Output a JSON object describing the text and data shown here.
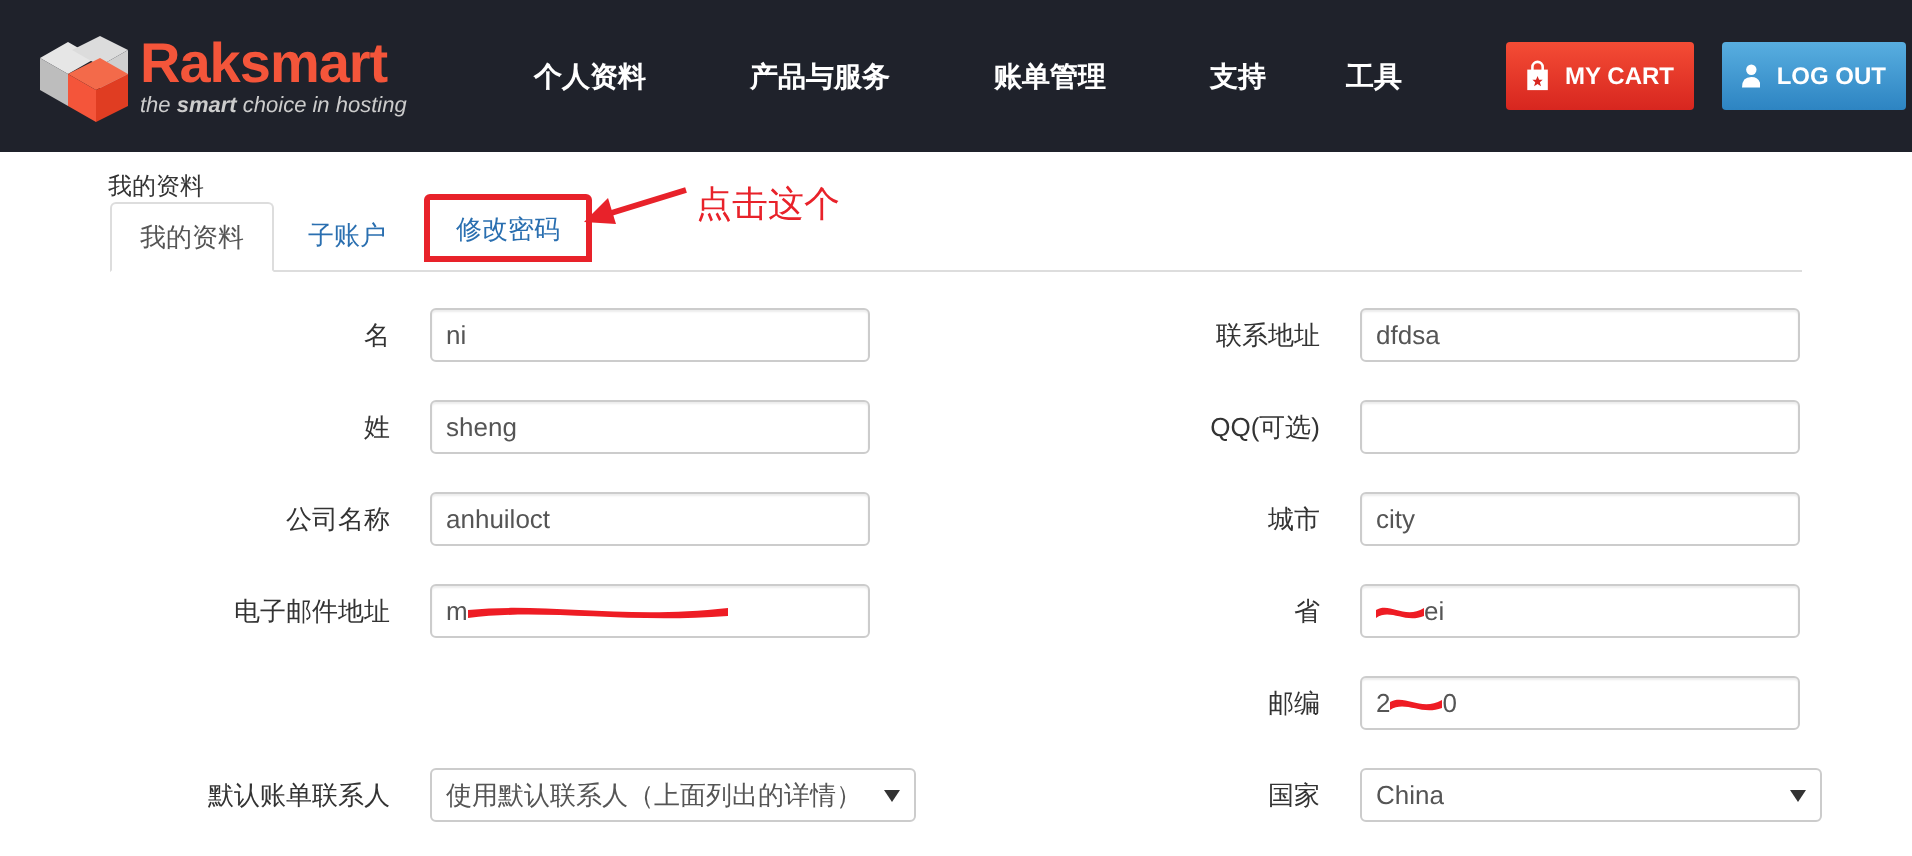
{
  "header": {
    "logo": {
      "name": "Raksmart",
      "tagline_before": "the ",
      "tagline_bold": "smart",
      "tagline_after": " choice in hosting"
    },
    "nav": [
      "个人资料",
      "产品与服务",
      "账单管理",
      "支持",
      "工具"
    ],
    "buttons": [
      {
        "label": "MY CART",
        "kind": "cart"
      },
      {
        "label": "LOG OUT",
        "kind": "logout"
      }
    ]
  },
  "breadcrumb": "我的资料",
  "tabs": [
    {
      "label": "我的资料",
      "selected": true,
      "highlighted": false
    },
    {
      "label": "子账户",
      "selected": false,
      "highlighted": false
    },
    {
      "label": "修改密码",
      "selected": false,
      "highlighted": true
    }
  ],
  "annotation": "点击这个",
  "rows": [
    {
      "left": {
        "label": "名",
        "kind": "text",
        "value": "ni"
      },
      "right": {
        "label": "联系地址",
        "kind": "text",
        "value": "dfdsa"
      }
    },
    {
      "left": {
        "label": "姓",
        "kind": "text",
        "value": "sheng"
      },
      "right": {
        "label": "QQ(可选)",
        "kind": "text"
      }
    },
    {
      "left": {
        "label": "公司名称",
        "kind": "text",
        "value": "anhuiloct"
      },
      "right": {
        "label": "城市",
        "kind": "text",
        "value": "city"
      }
    },
    {
      "left": {
        "label": "电子邮件地址",
        "kind": "text",
        "value": "m",
        "redacted": true
      },
      "right": {
        "label": "省",
        "kind": "text",
        "value_end": "ei",
        "redacted": true
      }
    },
    {
      "right": {
        "label": "邮编",
        "kind": "text",
        "value": "2",
        "value_end": "0",
        "redacted": true
      }
    },
    {
      "left": {
        "label": "默认账单联系人",
        "kind": "select",
        "value": "使用默认联系人（上面列出的详情）"
      },
      "right": {
        "label": "国家",
        "kind": "select",
        "value": "China"
      }
    }
  ]
}
